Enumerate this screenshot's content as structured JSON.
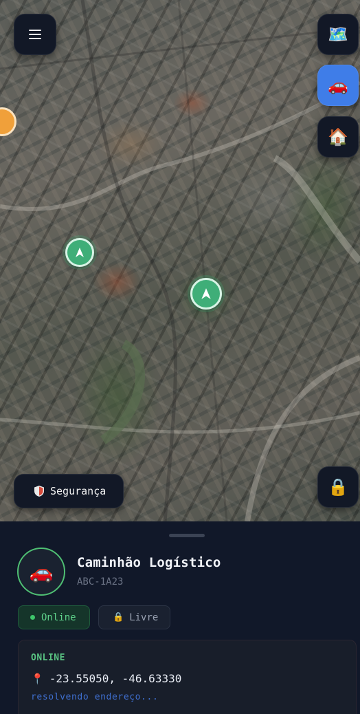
{
  "map": {
    "menu_icon": "hamburger-menu-icon",
    "layers_icon": "map-icon",
    "vehicle_icon": "car-icon",
    "home_icon": "house-icon",
    "lock_icon": "lock-icon",
    "security_label": "Segurança",
    "security_icon": "shield-icon",
    "markers": [
      {
        "type": "navigation-arrow",
        "color": "#3fae78"
      },
      {
        "type": "navigation-arrow",
        "color": "#3fae78"
      },
      {
        "type": "partial-marker",
        "color": "#f0a03a"
      }
    ]
  },
  "vehicle": {
    "name": "Caminhão Logístico",
    "plate": "ABC-1A23",
    "avatar_icon": "car-icon"
  },
  "chips": {
    "online_label": "Online",
    "free_label": "Livre",
    "free_icon": "lock-icon"
  },
  "status": {
    "title": "ONLINE",
    "coordinates": "-23.55050, -46.63330",
    "pin_icon": "pin-icon",
    "address": "resolvendo endereço..."
  },
  "colors": {
    "online": "#4fbf73",
    "active_button": "#3f7de8",
    "address_link": "#3f6fd0",
    "background": "#111829"
  }
}
